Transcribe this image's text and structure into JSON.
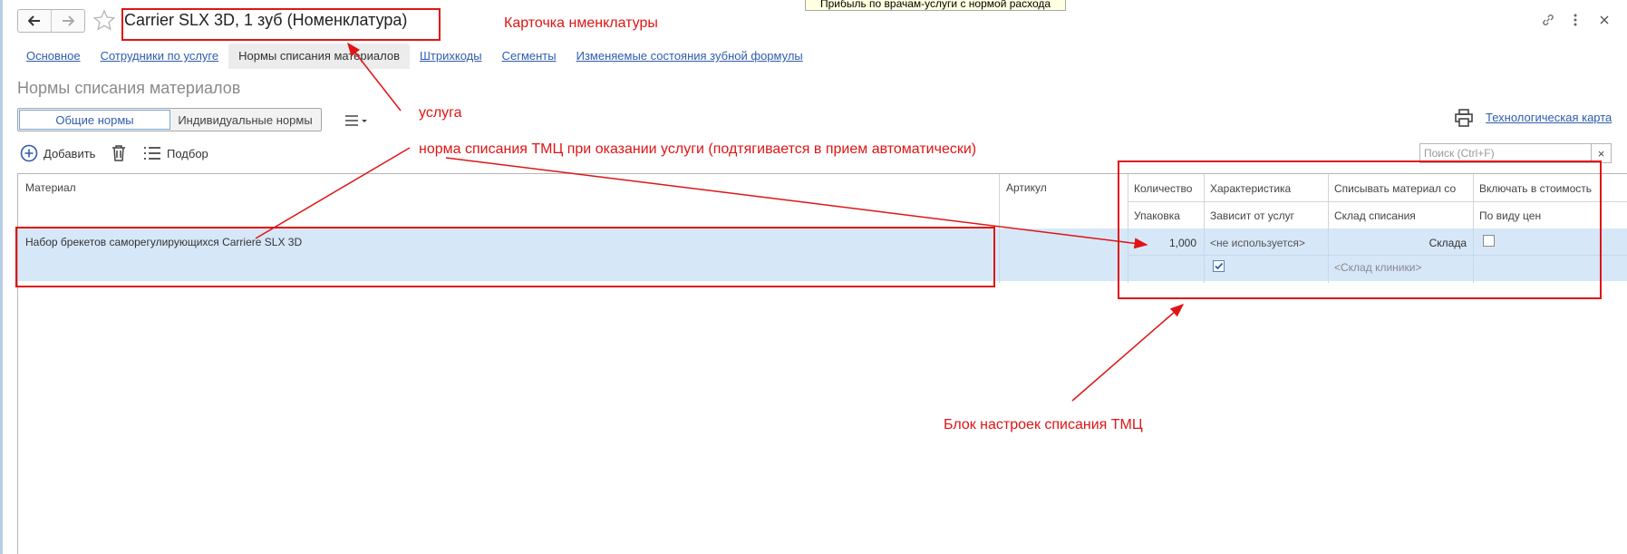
{
  "window": {
    "title": "Carrier SLX 3D, 1 зуб (Номенклатура)",
    "tooltip": "Прибыль по врачам-услуги с нормой расхода"
  },
  "tabs": [
    {
      "label": "Основное"
    },
    {
      "label": "Сотрудники по услуге"
    },
    {
      "label": "Нормы списания материалов"
    },
    {
      "label": "Штрихкоды"
    },
    {
      "label": "Сегменты"
    },
    {
      "label": "Изменяемые состояния зубной формулы"
    }
  ],
  "section": {
    "title": "Нормы списания материалов"
  },
  "segment": {
    "general": "Общие нормы",
    "individual": "Индивидуальные нормы"
  },
  "toolbar": {
    "add": "Добавить",
    "pick": "Подбор"
  },
  "tech_card": {
    "label": "Технологическая карта"
  },
  "search": {
    "placeholder": "Поиск (Ctrl+F)",
    "clear": "×"
  },
  "table": {
    "headers": {
      "material": "Материал",
      "article": "Артикул",
      "quantity": "Количество",
      "package": "Упаковка",
      "characteristic": "Характеристика",
      "depends": "Зависит от услуг",
      "writeoff_from": "Списывать материал со",
      "warehouse": "Склад списания",
      "include_cost": "Включать в стоимость",
      "price_type": "По виду цен"
    },
    "rows": [
      {
        "material": "Набор брекетов саморегулирующихся Carriere SLX 3D",
        "quantity": "1,000",
        "characteristic": "<не используется>",
        "writeoff_from": "Склада",
        "warehouse": "<Склад клиники>",
        "depends_checked": true,
        "include_checked": false
      }
    ]
  },
  "annotations": {
    "card": "Карточка нменклатуры",
    "service": "услуга",
    "norm": "норма списания ТМЦ при оказании услуги (подтягивается в прием автоматически)",
    "block": "Блок настроек списания ТМЦ"
  },
  "colors": {
    "annotation": "#e01414",
    "link": "#2e5dad",
    "row_selected": "#d6e7f8"
  }
}
